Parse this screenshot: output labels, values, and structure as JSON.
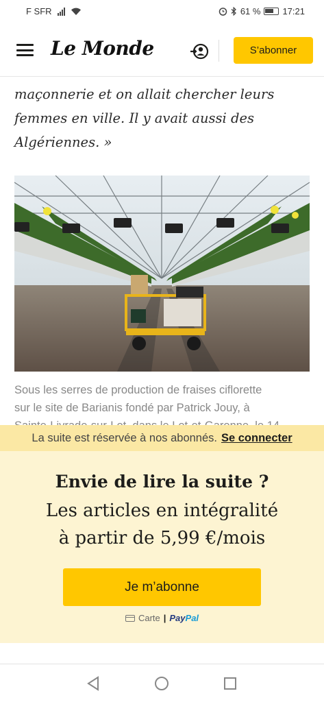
{
  "status_bar": {
    "carrier": "F SFR",
    "battery_text": "61 %",
    "time": "17:21"
  },
  "header": {
    "logo": "Le Monde",
    "subscribe_label": "S’abonner"
  },
  "article": {
    "quote_lines": [
      "maçonnerie et on allait chercher leurs",
      "femmes en ville. Il y avait aussi des",
      "Algériennes. »"
    ],
    "caption_lines": [
      "Sous les serres de production de fraises ciflorette",
      "sur le site de Barianis fondé par Patrick Jouy, à",
      "Sainte-Livrade-sur-Lot, dans le Lot-et-Garonne, le 14"
    ]
  },
  "paywall": {
    "bar_text": "La suite est réservée à nos abonnés.",
    "bar_link": "Se connecter",
    "title": "Envie de lire la suite ?",
    "line1": "Les articles en intégralité",
    "line2": "à partir de 5,99 €/mois",
    "button_label": "Je m’abonne",
    "payment_card": "Carte",
    "payment_sep": "|",
    "payment_paypal_a": "Pay",
    "payment_paypal_b": "Pal"
  },
  "colors": {
    "accent_yellow": "#ffc700",
    "paywall_bar": "#fbe8a4",
    "paywall_bg": "#fdf4d2"
  }
}
